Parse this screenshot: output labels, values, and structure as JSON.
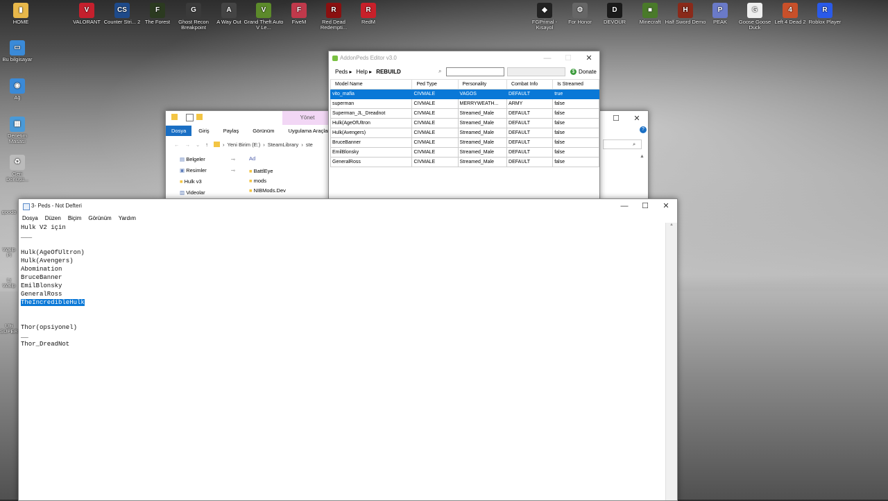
{
  "desktop": {
    "top_icons": [
      {
        "label": "HOME",
        "color": "#e8b84a",
        "glyph": "▮"
      },
      {
        "label": "VALORANT",
        "color": "#c5202d",
        "glyph": "V"
      },
      {
        "label": "Counter Stri... 2",
        "color": "#1e4a8a",
        "glyph": "CS"
      },
      {
        "label": "The Forest",
        "color": "#2b3a20",
        "glyph": "F"
      },
      {
        "label": "Ghost Recon Breakpoint",
        "color": "#3a3a3a",
        "glyph": "G"
      },
      {
        "label": "A Way Out",
        "color": "#444",
        "glyph": "A"
      },
      {
        "label": "Grand Theft Auto V Le...",
        "color": "#5c8a2a",
        "glyph": "V"
      },
      {
        "label": "FiveM",
        "color": "#c0394b",
        "glyph": "F"
      },
      {
        "label": "Red Dead Redempti...",
        "color": "#8a1010",
        "glyph": "R"
      },
      {
        "label": "RedM",
        "color": "#c8202a",
        "glyph": "R"
      }
    ],
    "right_icons": [
      {
        "label": "FGPrimal - Kısayol",
        "color": "#222",
        "glyph": "◆"
      },
      {
        "label": "For Honor",
        "color": "#666",
        "glyph": "⚙"
      },
      {
        "label": "DEVOUR",
        "color": "#1a1a1a",
        "glyph": "D"
      },
      {
        "label": "Minecraft",
        "color": "#4a7a2a",
        "glyph": "■"
      },
      {
        "label": "Half Sword Demo",
        "color": "#8a2a1a",
        "glyph": "H"
      },
      {
        "label": "PEAK",
        "color": "#6a7ac8",
        "glyph": "P"
      },
      {
        "label": "Goose Goose Duck",
        "color": "#eee",
        "glyph": "G"
      },
      {
        "label": "Left 4 Dead 2",
        "color": "#c8502a",
        "glyph": "4"
      },
      {
        "label": "Roblox Player",
        "color": "#2a5ae8",
        "glyph": "R"
      }
    ],
    "left_icons": [
      {
        "label": "Bu bilgisayar",
        "color": "#3a8ad8",
        "glyph": "▭"
      },
      {
        "label": "Ağ",
        "color": "#3a8ad8",
        "glyph": "◉"
      },
      {
        "label": "Denetim Masası",
        "color": "#4a9ad8",
        "glyph": "▦"
      },
      {
        "label": "Geri Dönüşü...",
        "color": "#bbb",
        "glyph": "♻"
      }
    ],
    "left_partial": [
      "goodb",
      "Wallp Pl",
      "Li Wallp",
      "Ulti SUPERI"
    ]
  },
  "addonpeds": {
    "title": "AddonPeds Editor v3.0",
    "menu_peds": "Peds",
    "menu_help": "Help",
    "menu_rebuild": "REBUILD",
    "donate": "Donate",
    "columns": [
      "Model Name",
      "Ped Type",
      "Personality",
      "Combat Info",
      "Is Streamed"
    ],
    "rows": [
      [
        "vito_mafia",
        "CIVMALE",
        "VAGOS",
        "DEFAULT",
        "true"
      ],
      [
        "superman",
        "CIVMALE",
        "MERRYWEATH...",
        "ARMY",
        "false"
      ],
      [
        "Superman_JL_Dreadnot",
        "CIVMALE",
        "Streamed_Male",
        "DEFAULT",
        "false"
      ],
      [
        "Hulk(AgeOfUltron",
        "CIVMALE",
        "Streamed_Male",
        "DEFAULT",
        "false"
      ],
      [
        "Hulk(Avengers)",
        "CIVMALE",
        "Streamed_Male",
        "DEFAULT",
        "false"
      ],
      [
        "BruceBanner",
        "CIVMALE",
        "Streamed_Male",
        "DEFAULT",
        "false"
      ],
      [
        "EmilBlonsky",
        "CIVMALE",
        "Streamed_Male",
        "DEFAULT",
        "false"
      ],
      [
        "GeneralRoss",
        "CIVMALE",
        "Streamed_Male",
        "DEFAULT",
        "false"
      ]
    ]
  },
  "explorer": {
    "ribbon_tab_manage": "Yönet",
    "tabs": [
      "Dosya",
      "Giriş",
      "Paylaş",
      "Görünüm",
      "Uygulama Araçları"
    ],
    "path": [
      "Yeni Birim (E:)",
      "SteamLibrary",
      "ste"
    ],
    "nav": [
      "Belgeler",
      "Resimler",
      "Hulk v3",
      "Videolar"
    ],
    "col_name": "Ad",
    "files": [
      "BattlEye",
      "mods",
      "NIBMods.Dev"
    ]
  },
  "notepad": {
    "title": "3- Peds - Not Defteri",
    "menu": [
      "Dosya",
      "Düzen",
      "Biçim",
      "Görünüm",
      "Yardım"
    ],
    "lines_before": "Hulk V2 için\n___\n\nHulk(AgeOfUltron)\nHulk(Avengers)\nAbomination\nBruceBanner\nEmilBlonsky\nGeneralRoss\n",
    "selected": "TheIncredibleHulk",
    "lines_after": "\n\n\nThor(opsiyonel)\n__\nThor_DreadNot"
  }
}
